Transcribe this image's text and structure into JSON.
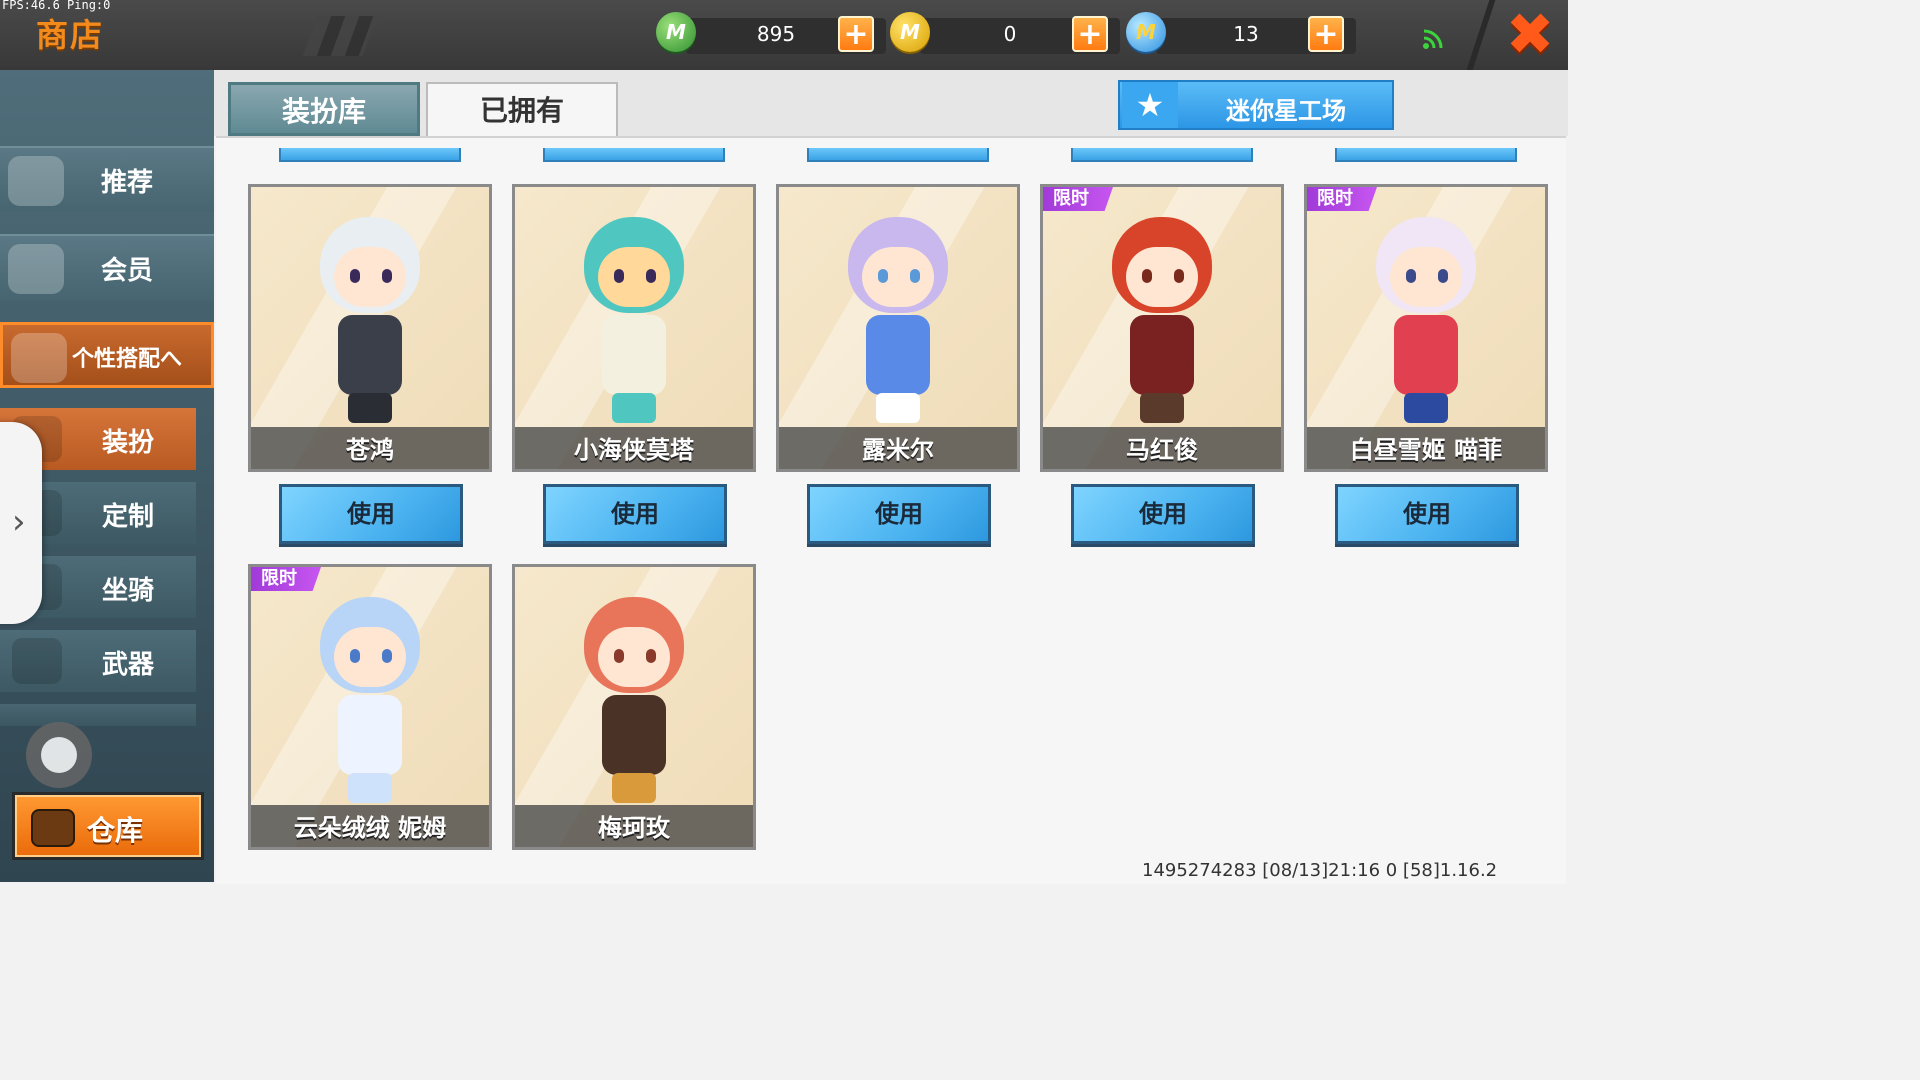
{
  "debug": {
    "fps": "FPS:46.6  Ping:0"
  },
  "header": {
    "title": "商店",
    "currencies": [
      {
        "icon": "mini-bean-icon",
        "value": "895"
      },
      {
        "icon": "mini-coin-icon",
        "value": "0"
      },
      {
        "icon": "mini-point-icon",
        "value": "13"
      }
    ],
    "close_icon": "close-icon",
    "signal_icon": "wifi-signal-icon"
  },
  "sidebar": {
    "items": [
      {
        "label": "推荐"
      },
      {
        "label": "会员"
      },
      {
        "label": "个性搭配へ"
      }
    ],
    "subitems": [
      {
        "label": "装扮"
      },
      {
        "label": "定制"
      },
      {
        "label": "坐骑"
      },
      {
        "label": "武器"
      }
    ],
    "warehouse_label": "仓库",
    "drawer_arrow": "›"
  },
  "tabs": [
    {
      "label": "装扮库"
    },
    {
      "label": "已拥有"
    }
  ],
  "workshop": {
    "label": "迷你星工场"
  },
  "limited_label": "限时",
  "use_label": "使用",
  "cards": [
    {
      "name": "苍鸿",
      "limited": false
    },
    {
      "name": "小海侠莫塔",
      "limited": false
    },
    {
      "name": "露米尔",
      "limited": false
    },
    {
      "name": "马红俊",
      "limited": true
    },
    {
      "name": "白昼雪姬 喵菲",
      "limited": true
    },
    {
      "name": "云朵绒绒 妮姆",
      "limited": true
    },
    {
      "name": "梅珂玫",
      "limited": false
    }
  ],
  "footer": {
    "text": "1495274283   [08/13]21:16 0   [58]1.16.2"
  }
}
